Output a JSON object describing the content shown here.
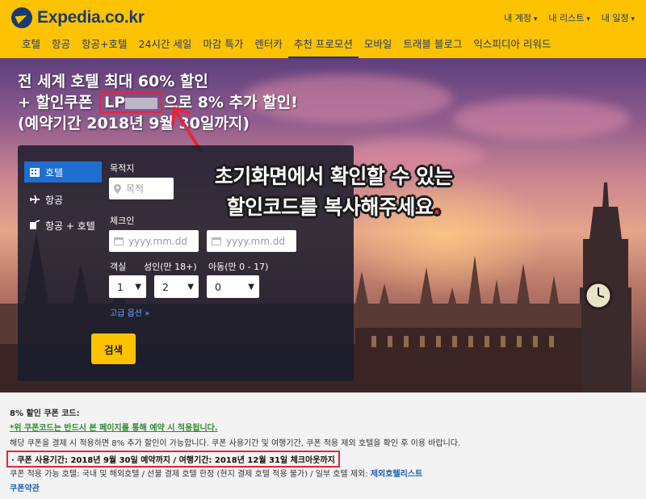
{
  "header": {
    "logo_text": "Expedia.co.kr",
    "util_links": [
      "내 계정",
      "내 리스트",
      "내 일정"
    ],
    "nav": [
      "호텔",
      "항공",
      "항공+호텔",
      "24시간 세일",
      "마감 특가",
      "렌터카",
      "추천 프로모션",
      "모바일",
      "트래블 블로그",
      "익스피디아 리워드"
    ],
    "active_nav": "추천 프로모션"
  },
  "hero": {
    "line1": "전 세계 호텔 최대 60% 할인",
    "line2_prefix": "+ 할인쿠폰",
    "code_visible": "LP",
    "line2_suffix": "으로 8% 추가 할인!",
    "line3": "(예약기간 2018년 9월 30일까지)",
    "overlay_line1": "초기화면에서 확인할 수 있는",
    "overlay_line2": "할인코드를 복사해주세요",
    "overlay_dot": ".",
    "colors": {
      "accent_red": "#e8243a",
      "brand_yellow": "#fdc300",
      "brand_navy": "#1d3a6e"
    }
  },
  "search": {
    "tabs": [
      {
        "label": "호텔",
        "icon": "hotel-icon"
      },
      {
        "label": "항공",
        "icon": "plane-icon"
      },
      {
        "label": "항공 + 호텔",
        "icon": "plane-hotel-icon"
      }
    ],
    "destination_label": "목적지",
    "destination_placeholder": "목적",
    "checkin_label": "체크인",
    "checkin_placeholder": "yyyy.mm.dd",
    "checkout_placeholder": "yyyy.mm.dd",
    "rooms_label": "객실",
    "rooms_value": "1",
    "adults_label": "성인(만 18+)",
    "adults_value": "2",
    "children_label": "아동(만 0 - 17)",
    "children_value": "0",
    "advanced_label": "고급 옵션",
    "button_label": "검색"
  },
  "info": {
    "title": "8% 할인 쿠폰 코드:",
    "warning": "*위 쿠폰코드는 반드시 본 페이지를 통해 예약 시 적용됩니다.",
    "desc": "해당 쿠폰을 결제 시 적용하면 8% 추가 할인이 가능합니다. 쿠폰 사용기간 및 여행기간, 쿠폰 적용 제외 호텔을 확인 후 이용 바랍니다.",
    "period": "· 쿠폰 사용기간: 2018년 9월 30일 예약까지 / 여행기간: 2018년 12월 31일 체크아웃까지",
    "hotels_prefix": "쿠폰 적용 가능 호텔: 국내 및 해외호텔 / 선불 결제 호텔 한정 (현지 결제 호텔 적용 불가) / 일부 호텔 제외: ",
    "hotels_link": "제외호텔리스트",
    "terms": "쿠폰약관"
  }
}
